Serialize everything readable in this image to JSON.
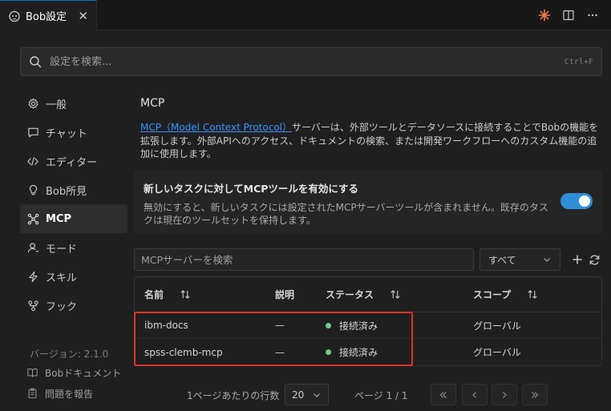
{
  "tab": {
    "title": "Bob設定",
    "close_glyph": "✕"
  },
  "search": {
    "placeholder": "設定を検索...",
    "shortcut": "Ctrl+F"
  },
  "sidebar": {
    "items": [
      {
        "label": "一般",
        "icon": "gear-icon"
      },
      {
        "label": "チャット",
        "icon": "chat-icon"
      },
      {
        "label": "エディター",
        "icon": "code-icon"
      },
      {
        "label": "Bob所見",
        "icon": "lightbulb-icon"
      },
      {
        "label": "MCP",
        "icon": "mcp-icon",
        "active": true
      },
      {
        "label": "モード",
        "icon": "user-mode-icon"
      },
      {
        "label": "スキル",
        "icon": "lightning-icon"
      },
      {
        "label": "フック",
        "icon": "hook-icon"
      }
    ],
    "version": "バージョン: 2.1.0",
    "docs_link": "Bobドキュメント",
    "report_link": "問題を報告"
  },
  "main": {
    "heading": "MCP",
    "description_link": "MCP（Model Context Protocol）",
    "description_rest": "サーバーは、外部ツールとデータソースに接続することでBobの機能を拡張します。外部APIへのアクセス、ドキュメントの検索、または開発ワークフローへのカスタム機能の追加に使用します。",
    "toggle": {
      "title": "新しいタスクに対してMCPツールを有効にする",
      "description": "無効にすると、新しいタスクには設定されたMCPサーバーツールが含まれません。既存のタスクは現在のツールセットを保持します。",
      "enabled": true
    },
    "filter": {
      "search_placeholder": "MCPサーバーを検索",
      "scope_selected": "すべて"
    },
    "table": {
      "columns": [
        "名前",
        "説明",
        "ステータス",
        "スコープ"
      ],
      "rows": [
        {
          "name": "ibm-docs",
          "description": "—",
          "status": "接続済み",
          "scope": "グローバル"
        },
        {
          "name": "spss-clemb-mcp",
          "description": "—",
          "status": "接続済み",
          "scope": "グローバル"
        }
      ]
    },
    "pagination": {
      "rows_per_page_label": "1ページあたりの行数",
      "rows_per_page": "20",
      "page_info": "ページ 1 / 1"
    }
  },
  "colors": {
    "accent": "#2f8fd6",
    "status_connected": "#73c991",
    "highlight": "#d6362b",
    "link": "#3794ff"
  }
}
